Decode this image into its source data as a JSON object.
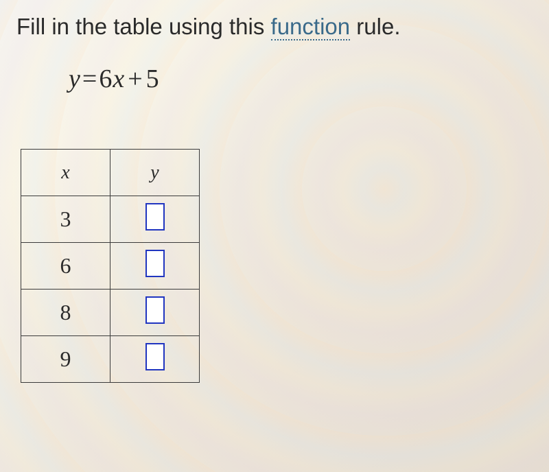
{
  "instruction": {
    "prefix": "Fill in the table using this ",
    "link_text": "function",
    "suffix": " rule."
  },
  "equation": {
    "lhs_var": "y",
    "equals": "=",
    "coeff": "6",
    "rhs_var": "x",
    "plus": "+",
    "constant": "5"
  },
  "table": {
    "headers": {
      "x": "x",
      "y": "y"
    },
    "rows": [
      {
        "x": "3",
        "y": ""
      },
      {
        "x": "6",
        "y": ""
      },
      {
        "x": "8",
        "y": ""
      },
      {
        "x": "9",
        "y": ""
      }
    ]
  }
}
